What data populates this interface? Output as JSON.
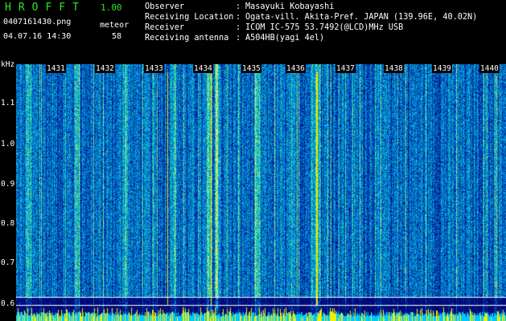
{
  "app": {
    "name": "HROFFT",
    "version": "1.00"
  },
  "file": {
    "name": "0407161430.png",
    "datetime": "04.07.16 14:30"
  },
  "meteor": {
    "label": "meteor",
    "count": "58"
  },
  "info": [
    {
      "key": "Observer",
      "value": "Masayuki Kobayashi"
    },
    {
      "key": "Receiving Location",
      "value": "Ogata-vill. Akita-Pref. JAPAN (139.96E, 40.02N)"
    },
    {
      "key": "Receiver",
      "value": "ICOM IC-575 53.7492(@LCD)MHz USB"
    },
    {
      "key": "Receiving antenna",
      "value": "A504HB(yagi 4el)"
    }
  ],
  "axis": {
    "unit": "kHz",
    "y_labels": [
      "1.1",
      "1.0",
      "0.9",
      "0.8",
      "0.7",
      "0.6"
    ],
    "time_labels": [
      "1431",
      "1432",
      "1433",
      "1434",
      "1435",
      "1436",
      "1437",
      "1438",
      "1439",
      "1440"
    ]
  },
  "colors": {
    "header_green": "#29e629",
    "background": "#000000",
    "grid": "#ffffff"
  }
}
